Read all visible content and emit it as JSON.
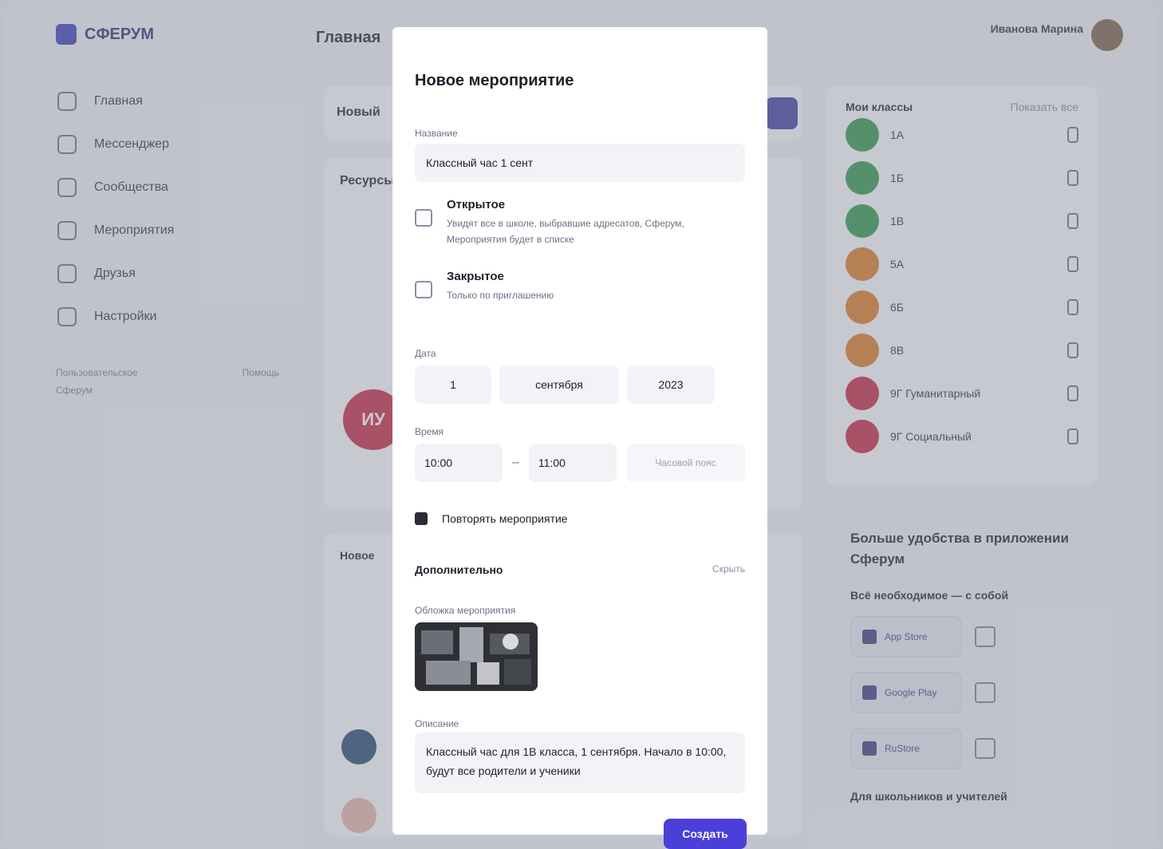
{
  "app": {
    "logo_text": "СФЕРУМ",
    "page_title": "Главная",
    "user_name": "Иванова Марина"
  },
  "sidebar": {
    "items": [
      {
        "label": "Главная",
        "icon": "home-icon"
      },
      {
        "label": "Мессенджер",
        "icon": "chat-icon"
      },
      {
        "label": "Сообщества",
        "icon": "community-icon"
      },
      {
        "label": "Мероприятия",
        "icon": "events-icon"
      },
      {
        "label": "Друзья",
        "icon": "friends-icon"
      },
      {
        "label": "Настройки",
        "icon": "settings-icon"
      }
    ],
    "footer": {
      "left": "Пользовательское",
      "right": "Помощь",
      "second": "Сферум"
    }
  },
  "center": {
    "input_label": "Новый",
    "section_label": "Ресурсы",
    "avatar_initials": "ИУ",
    "list_label": "Новое"
  },
  "contacts": {
    "title": "Мои классы",
    "link": "Показать все",
    "items": [
      {
        "name": "1А",
        "color": "#2f9a47"
      },
      {
        "name": "1Б",
        "color": "#2f9a47"
      },
      {
        "name": "1В",
        "color": "#2f9a47"
      },
      {
        "name": "5А",
        "color": "#e07a1f"
      },
      {
        "name": "6Б",
        "color": "#e07a1f"
      },
      {
        "name": "8В",
        "color": "#e07a1f"
      },
      {
        "name": "9Г Гуманитарный",
        "color": "#c9253e"
      },
      {
        "name": "9Г Социальный",
        "color": "#c9253e"
      }
    ]
  },
  "promo": {
    "title": "Больше удобства в приложении Сферум",
    "subtitle": "Всё необходимое — с собой",
    "stores": [
      {
        "label": "App Store",
        "icon": "apple-icon"
      },
      {
        "label": "Google Play",
        "icon": "play-icon"
      },
      {
        "label": "RuStore",
        "icon": "rustore-icon"
      }
    ],
    "bottom": "Для школьников и учителей"
  },
  "modal": {
    "title": "Новое мероприятие",
    "name_label": "Название",
    "name_value": "Классный час 1 сент",
    "option_public_title": "Открытое",
    "option_public_desc": "Увидят все в школе, выбравшие адресатов, Сферум, Мероприятия будет в списке",
    "option_private_title": "Закрытое",
    "option_private_desc": "Только по приглашению",
    "date_label": "Дата",
    "date_day": "1",
    "date_month": "сентября",
    "date_year": "2023",
    "time_label": "Время",
    "time_start": "10:00",
    "time_end": "11:00",
    "time_extra": "Часовой пояс",
    "checkbox_label": "Повторять мероприятие",
    "optional_title": "Дополнительно",
    "optional_link": "Скрыть",
    "cover_label": "Обложка мероприятия",
    "desc_label": "Описание",
    "desc_value": "Классный час для 1В класса, 1 сентября. Начало в 10:00, будут все родители и ученики",
    "submit_label": "Создать"
  }
}
